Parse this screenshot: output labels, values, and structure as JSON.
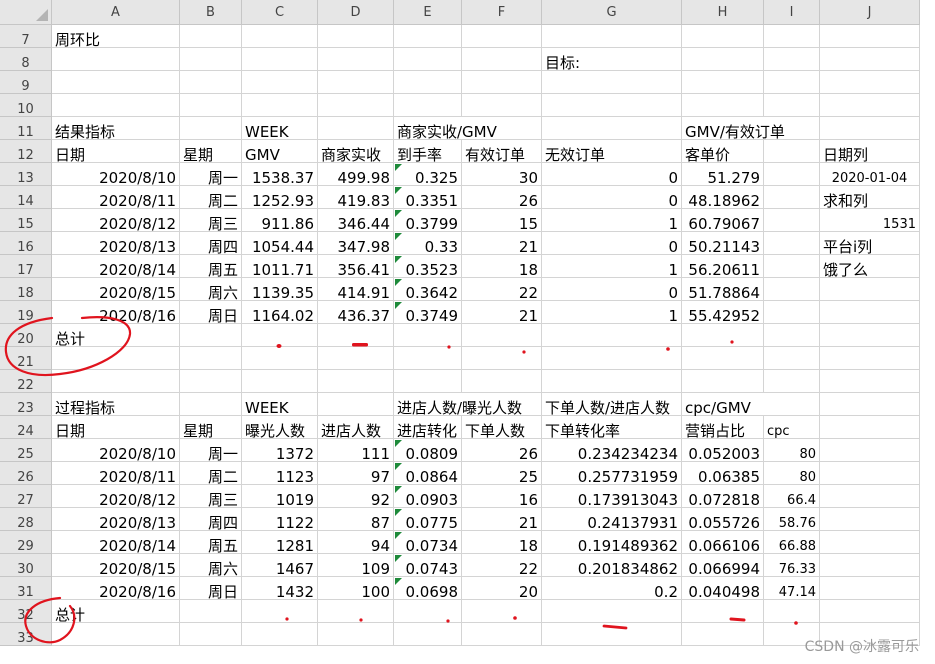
{
  "columns": [
    "A",
    "B",
    "C",
    "D",
    "E",
    "F",
    "G",
    "H",
    "I",
    "J"
  ],
  "rows": [
    {
      "num": "7",
      "cells": [
        {
          "col": "A",
          "text": "周环比",
          "align": "l"
        }
      ]
    },
    {
      "num": "8",
      "cells": [
        {
          "col": "G",
          "text": "目标:",
          "align": "l"
        }
      ]
    },
    {
      "num": "9",
      "cells": []
    },
    {
      "num": "10",
      "cells": []
    },
    {
      "num": "11",
      "cells": [
        {
          "col": "A",
          "text": "结果指标",
          "align": "l"
        },
        {
          "col": "C",
          "text": "WEEK",
          "align": "l"
        },
        {
          "col": "E",
          "text": "商家实收/GMV",
          "align": "l",
          "spill": true
        },
        {
          "col": "H",
          "text": "GMV/有效订单",
          "align": "l",
          "spill": true
        }
      ]
    },
    {
      "num": "12",
      "cells": [
        {
          "col": "A",
          "text": "日期",
          "align": "l"
        },
        {
          "col": "B",
          "text": "星期",
          "align": "l"
        },
        {
          "col": "C",
          "text": "GMV",
          "align": "l"
        },
        {
          "col": "D",
          "text": "商家实收",
          "align": "l"
        },
        {
          "col": "E",
          "text": "到手率",
          "align": "l"
        },
        {
          "col": "F",
          "text": "有效订单",
          "align": "l"
        },
        {
          "col": "G",
          "text": "无效订单",
          "align": "l"
        },
        {
          "col": "H",
          "text": "客单价",
          "align": "l"
        },
        {
          "col": "J",
          "text": "日期列",
          "align": "l"
        }
      ]
    },
    {
      "num": "13",
      "cells": [
        {
          "col": "A",
          "text": "2020/8/10",
          "align": "r"
        },
        {
          "col": "B",
          "text": "周一",
          "align": "r"
        },
        {
          "col": "C",
          "text": "1538.37",
          "align": "r"
        },
        {
          "col": "D",
          "text": "499.98",
          "align": "r"
        },
        {
          "col": "E",
          "text": "0.325",
          "align": "r",
          "flag": true
        },
        {
          "col": "F",
          "text": "30",
          "align": "r"
        },
        {
          "col": "G",
          "text": "0",
          "align": "r"
        },
        {
          "col": "H",
          "text": "51.279",
          "align": "r"
        },
        {
          "col": "J",
          "text": "2020-01-04",
          "align": "c",
          "small": true
        }
      ]
    },
    {
      "num": "14",
      "cells": [
        {
          "col": "A",
          "text": "2020/8/11",
          "align": "r"
        },
        {
          "col": "B",
          "text": "周二",
          "align": "r"
        },
        {
          "col": "C",
          "text": "1252.93",
          "align": "r"
        },
        {
          "col": "D",
          "text": "419.83",
          "align": "r"
        },
        {
          "col": "E",
          "text": "0.3351",
          "align": "r",
          "flag": true
        },
        {
          "col": "F",
          "text": "26",
          "align": "r"
        },
        {
          "col": "G",
          "text": "0",
          "align": "r"
        },
        {
          "col": "H",
          "text": "48.18962",
          "align": "r"
        },
        {
          "col": "J",
          "text": "求和列",
          "align": "l"
        }
      ]
    },
    {
      "num": "15",
      "cells": [
        {
          "col": "A",
          "text": "2020/8/12",
          "align": "r"
        },
        {
          "col": "B",
          "text": "周三",
          "align": "r"
        },
        {
          "col": "C",
          "text": "911.86",
          "align": "r"
        },
        {
          "col": "D",
          "text": "346.44",
          "align": "r"
        },
        {
          "col": "E",
          "text": "0.3799",
          "align": "r",
          "flag": true
        },
        {
          "col": "F",
          "text": "15",
          "align": "r"
        },
        {
          "col": "G",
          "text": "1",
          "align": "r"
        },
        {
          "col": "H",
          "text": "60.79067",
          "align": "r"
        },
        {
          "col": "J",
          "text": "1531",
          "align": "r",
          "small": true
        }
      ]
    },
    {
      "num": "16",
      "cells": [
        {
          "col": "A",
          "text": "2020/8/13",
          "align": "r"
        },
        {
          "col": "B",
          "text": "周四",
          "align": "r"
        },
        {
          "col": "C",
          "text": "1054.44",
          "align": "r"
        },
        {
          "col": "D",
          "text": "347.98",
          "align": "r"
        },
        {
          "col": "E",
          "text": "0.33",
          "align": "r",
          "flag": true
        },
        {
          "col": "F",
          "text": "21",
          "align": "r"
        },
        {
          "col": "G",
          "text": "0",
          "align": "r"
        },
        {
          "col": "H",
          "text": "50.21143",
          "align": "r"
        },
        {
          "col": "J",
          "text": "平台i列",
          "align": "l"
        }
      ]
    },
    {
      "num": "17",
      "cells": [
        {
          "col": "A",
          "text": "2020/8/14",
          "align": "r"
        },
        {
          "col": "B",
          "text": "周五",
          "align": "r"
        },
        {
          "col": "C",
          "text": "1011.71",
          "align": "r"
        },
        {
          "col": "D",
          "text": "356.41",
          "align": "r"
        },
        {
          "col": "E",
          "text": "0.3523",
          "align": "r",
          "flag": true
        },
        {
          "col": "F",
          "text": "18",
          "align": "r"
        },
        {
          "col": "G",
          "text": "1",
          "align": "r"
        },
        {
          "col": "H",
          "text": "56.20611",
          "align": "r"
        },
        {
          "col": "J",
          "text": "饿了么",
          "align": "l"
        }
      ]
    },
    {
      "num": "18",
      "cells": [
        {
          "col": "A",
          "text": "2020/8/15",
          "align": "r"
        },
        {
          "col": "B",
          "text": "周六",
          "align": "r"
        },
        {
          "col": "C",
          "text": "1139.35",
          "align": "r"
        },
        {
          "col": "D",
          "text": "414.91",
          "align": "r"
        },
        {
          "col": "E",
          "text": "0.3642",
          "align": "r",
          "flag": true
        },
        {
          "col": "F",
          "text": "22",
          "align": "r"
        },
        {
          "col": "G",
          "text": "0",
          "align": "r"
        },
        {
          "col": "H",
          "text": "51.78864",
          "align": "r"
        }
      ]
    },
    {
      "num": "19",
      "cells": [
        {
          "col": "A",
          "text": "2020/8/16",
          "align": "r"
        },
        {
          "col": "B",
          "text": "周日",
          "align": "r"
        },
        {
          "col": "C",
          "text": "1164.02",
          "align": "r"
        },
        {
          "col": "D",
          "text": "436.37",
          "align": "r"
        },
        {
          "col": "E",
          "text": "0.3749",
          "align": "r",
          "flag": true
        },
        {
          "col": "F",
          "text": "21",
          "align": "r"
        },
        {
          "col": "G",
          "text": "1",
          "align": "r"
        },
        {
          "col": "H",
          "text": "55.42952",
          "align": "r"
        }
      ]
    },
    {
      "num": "20",
      "cells": [
        {
          "col": "A",
          "text": "总计",
          "align": "l"
        }
      ]
    },
    {
      "num": "21",
      "cells": []
    },
    {
      "num": "22",
      "cells": []
    },
    {
      "num": "23",
      "cells": [
        {
          "col": "A",
          "text": "过程指标",
          "align": "l"
        },
        {
          "col": "C",
          "text": "WEEK",
          "align": "l"
        },
        {
          "col": "E",
          "text": "进店人数/曝光人数",
          "align": "l",
          "spill": true
        },
        {
          "col": "G",
          "text": "下单人数/进店人数",
          "align": "l",
          "spill": true
        },
        {
          "col": "H",
          "text": "cpc/GMV",
          "align": "l",
          "spill": true
        }
      ]
    },
    {
      "num": "24",
      "cells": [
        {
          "col": "A",
          "text": "日期",
          "align": "l"
        },
        {
          "col": "B",
          "text": "星期",
          "align": "l"
        },
        {
          "col": "C",
          "text": "曝光人数",
          "align": "l"
        },
        {
          "col": "D",
          "text": "进店人数",
          "align": "l"
        },
        {
          "col": "E",
          "text": "进店转化",
          "align": "l"
        },
        {
          "col": "F",
          "text": "下单人数",
          "align": "l"
        },
        {
          "col": "G",
          "text": "下单转化率",
          "align": "l"
        },
        {
          "col": "H",
          "text": "营销占比",
          "align": "l"
        },
        {
          "col": "I",
          "text": "cpc",
          "align": "l",
          "small": true
        }
      ]
    },
    {
      "num": "25",
      "cells": [
        {
          "col": "A",
          "text": "2020/8/10",
          "align": "r"
        },
        {
          "col": "B",
          "text": "周一",
          "align": "r"
        },
        {
          "col": "C",
          "text": "1372",
          "align": "r"
        },
        {
          "col": "D",
          "text": "111",
          "align": "r"
        },
        {
          "col": "E",
          "text": "0.0809",
          "align": "r",
          "flag": true
        },
        {
          "col": "F",
          "text": "26",
          "align": "r"
        },
        {
          "col": "G",
          "text": "0.234234234",
          "align": "r"
        },
        {
          "col": "H",
          "text": "0.052003",
          "align": "r"
        },
        {
          "col": "I",
          "text": "80",
          "align": "r",
          "small": true
        }
      ]
    },
    {
      "num": "26",
      "cells": [
        {
          "col": "A",
          "text": "2020/8/11",
          "align": "r"
        },
        {
          "col": "B",
          "text": "周二",
          "align": "r"
        },
        {
          "col": "C",
          "text": "1123",
          "align": "r"
        },
        {
          "col": "D",
          "text": "97",
          "align": "r"
        },
        {
          "col": "E",
          "text": "0.0864",
          "align": "r",
          "flag": true
        },
        {
          "col": "F",
          "text": "25",
          "align": "r"
        },
        {
          "col": "G",
          "text": "0.257731959",
          "align": "r"
        },
        {
          "col": "H",
          "text": "0.06385",
          "align": "r"
        },
        {
          "col": "I",
          "text": "80",
          "align": "r",
          "small": true
        }
      ]
    },
    {
      "num": "27",
      "cells": [
        {
          "col": "A",
          "text": "2020/8/12",
          "align": "r"
        },
        {
          "col": "B",
          "text": "周三",
          "align": "r"
        },
        {
          "col": "C",
          "text": "1019",
          "align": "r"
        },
        {
          "col": "D",
          "text": "92",
          "align": "r"
        },
        {
          "col": "E",
          "text": "0.0903",
          "align": "r",
          "flag": true
        },
        {
          "col": "F",
          "text": "16",
          "align": "r"
        },
        {
          "col": "G",
          "text": "0.173913043",
          "align": "r"
        },
        {
          "col": "H",
          "text": "0.072818",
          "align": "r"
        },
        {
          "col": "I",
          "text": "66.4",
          "align": "r",
          "small": true
        }
      ]
    },
    {
      "num": "28",
      "cells": [
        {
          "col": "A",
          "text": "2020/8/13",
          "align": "r"
        },
        {
          "col": "B",
          "text": "周四",
          "align": "r"
        },
        {
          "col": "C",
          "text": "1122",
          "align": "r"
        },
        {
          "col": "D",
          "text": "87",
          "align": "r"
        },
        {
          "col": "E",
          "text": "0.0775",
          "align": "r",
          "flag": true
        },
        {
          "col": "F",
          "text": "21",
          "align": "r"
        },
        {
          "col": "G",
          "text": "0.24137931",
          "align": "r"
        },
        {
          "col": "H",
          "text": "0.055726",
          "align": "r"
        },
        {
          "col": "I",
          "text": "58.76",
          "align": "r",
          "small": true
        }
      ]
    },
    {
      "num": "29",
      "cells": [
        {
          "col": "A",
          "text": "2020/8/14",
          "align": "r"
        },
        {
          "col": "B",
          "text": "周五",
          "align": "r"
        },
        {
          "col": "C",
          "text": "1281",
          "align": "r"
        },
        {
          "col": "D",
          "text": "94",
          "align": "r"
        },
        {
          "col": "E",
          "text": "0.0734",
          "align": "r",
          "flag": true
        },
        {
          "col": "F",
          "text": "18",
          "align": "r"
        },
        {
          "col": "G",
          "text": "0.191489362",
          "align": "r"
        },
        {
          "col": "H",
          "text": "0.066106",
          "align": "r"
        },
        {
          "col": "I",
          "text": "66.88",
          "align": "r",
          "small": true
        }
      ]
    },
    {
      "num": "30",
      "cells": [
        {
          "col": "A",
          "text": "2020/8/15",
          "align": "r"
        },
        {
          "col": "B",
          "text": "周六",
          "align": "r"
        },
        {
          "col": "C",
          "text": "1467",
          "align": "r"
        },
        {
          "col": "D",
          "text": "109",
          "align": "r"
        },
        {
          "col": "E",
          "text": "0.0743",
          "align": "r",
          "flag": true
        },
        {
          "col": "F",
          "text": "22",
          "align": "r"
        },
        {
          "col": "G",
          "text": "0.201834862",
          "align": "r"
        },
        {
          "col": "H",
          "text": "0.066994",
          "align": "r"
        },
        {
          "col": "I",
          "text": "76.33",
          "align": "r",
          "small": true
        }
      ]
    },
    {
      "num": "31",
      "cells": [
        {
          "col": "A",
          "text": "2020/8/16",
          "align": "r"
        },
        {
          "col": "B",
          "text": "周日",
          "align": "r"
        },
        {
          "col": "C",
          "text": "1432",
          "align": "r"
        },
        {
          "col": "D",
          "text": "100",
          "align": "r"
        },
        {
          "col": "E",
          "text": "0.0698",
          "align": "r",
          "flag": true
        },
        {
          "col": "F",
          "text": "20",
          "align": "r"
        },
        {
          "col": "G",
          "text": "0.2",
          "align": "r"
        },
        {
          "col": "H",
          "text": "0.040498",
          "align": "r"
        },
        {
          "col": "I",
          "text": "47.14",
          "align": "r",
          "small": true
        }
      ]
    },
    {
      "num": "32",
      "cells": [
        {
          "col": "A",
          "text": "总计",
          "align": "l"
        }
      ]
    },
    {
      "num": "33",
      "cells": []
    }
  ],
  "annotation_color": "#e0141e",
  "flag_color": "#1e8a3a",
  "watermark": "CSDN @冰露可乐"
}
